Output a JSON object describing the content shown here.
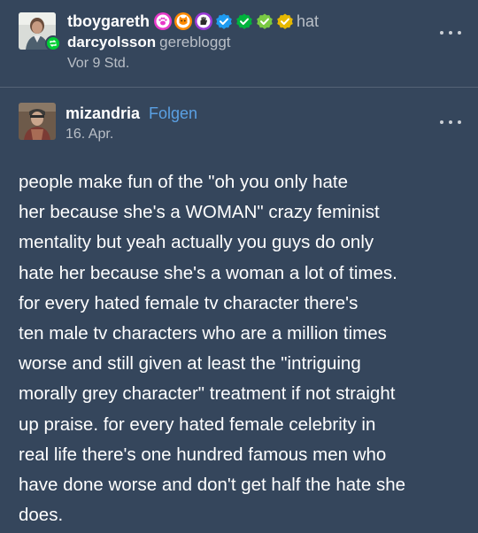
{
  "reblog": {
    "username": "tboygareth",
    "hat_label": "hat",
    "source_username": "darcyolsson",
    "action": "gerebloggt",
    "time": "Vor 9 Std."
  },
  "badges": [
    {
      "icon": "paw-badge-icon",
      "color": "#e73ac8"
    },
    {
      "icon": "cat-badge-icon",
      "color": "#ff8a00"
    },
    {
      "icon": "hand-badge-icon",
      "color": "#9b3ad6"
    },
    {
      "icon": "verified-blue-badge-icon",
      "color": "#1e9bf0"
    },
    {
      "icon": "verified-green-badge-icon",
      "color": "#00b33c"
    },
    {
      "icon": "verified-lime-badge-icon",
      "color": "#7ac943"
    },
    {
      "icon": "verified-yellow-badge-icon",
      "color": "#e6b800"
    }
  ],
  "post": {
    "username": "mizandria",
    "follow_label": "Folgen",
    "date": "16. Apr.",
    "lines": [
      "people make fun of the \"oh you only hate",
      "her because she's a WOMAN\" crazy feminist",
      "mentality but yeah actually you guys do only",
      "hate her because she's a woman a lot of times.",
      "for every hated female tv character there's",
      "ten male tv characters who are a million times",
      "worse and still given at least the \"intriguing",
      "morally grey character\" treatment if not straight",
      "up praise. for every hated female celebrity in",
      "real life there's one hundred famous men who",
      "have done worse and don't get half the hate she",
      "does."
    ]
  },
  "colors": {
    "card_background": "#35465c",
    "link": "#5aa0e3",
    "reblog_badge": "#00cf35"
  }
}
